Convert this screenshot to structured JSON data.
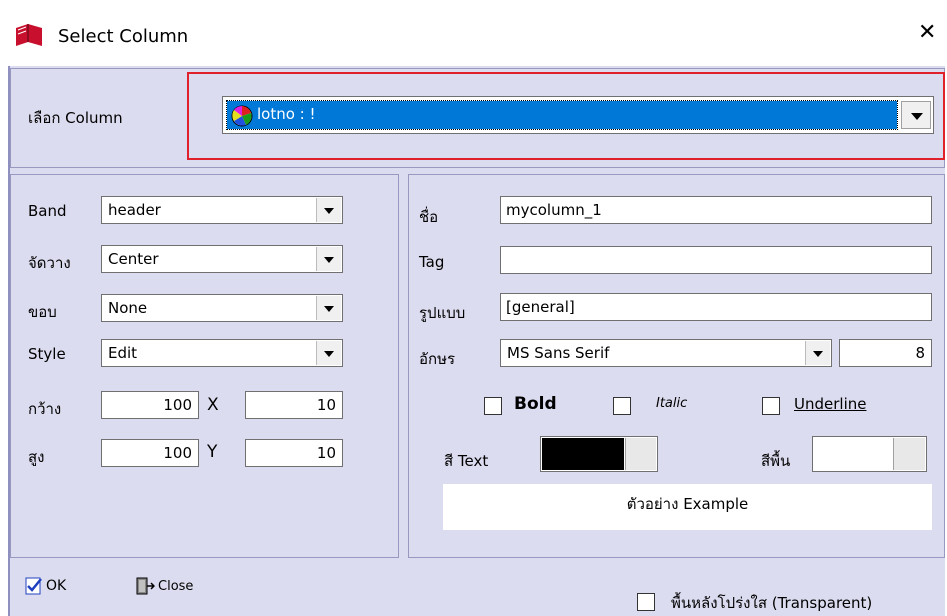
{
  "window": {
    "title": "Select Column",
    "close_glyph": "✕"
  },
  "select_column": {
    "label": "เลือก Column",
    "value": "lotno : !"
  },
  "left": {
    "band": {
      "label": "Band",
      "value": "header"
    },
    "align": {
      "label": "จัดวาง",
      "value": "Center"
    },
    "border": {
      "label": "ขอบ",
      "value": "None"
    },
    "style": {
      "label": "Style",
      "value": "Edit"
    },
    "width": {
      "label": "กว้าง",
      "value": "100"
    },
    "x": {
      "label": "X",
      "value": "10"
    },
    "height": {
      "label": "สูง",
      "value": "100"
    },
    "y": {
      "label": "Y",
      "value": "10"
    }
  },
  "right": {
    "name": {
      "label": "ชื่อ",
      "value": "mycolumn_1"
    },
    "tag": {
      "label": "Tag",
      "value": ""
    },
    "format": {
      "label": "รูปแบบ",
      "value": "[general]"
    },
    "font": {
      "label": "อักษร",
      "value": "MS Sans Serif",
      "size": "8"
    },
    "bold": {
      "label": "Bold",
      "checked": false
    },
    "italic": {
      "label": "Italic",
      "checked": false
    },
    "underline": {
      "label": "Underline",
      "checked": false
    },
    "text_color": {
      "label": "สี Text",
      "color": "#000000"
    },
    "bg_color": {
      "label": "สีพื้น",
      "color": "#ffffff"
    },
    "example": "ตัวอย่าง Example"
  },
  "footer": {
    "ok": "OK",
    "close": "Close",
    "transparent": "พื้นหลังโปร่งใส (Transparent)"
  },
  "colors": {
    "dialog_bg": "#dcdcf0",
    "selection": "#0078d7",
    "highlight_border": "#e0202a"
  }
}
